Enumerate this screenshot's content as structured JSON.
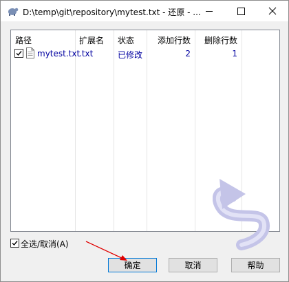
{
  "window": {
    "title": "D:\\temp\\git\\repository\\mytest.txt - 还原 - ..."
  },
  "columns": [
    "路径",
    "扩展名",
    "状态",
    "添加行数",
    "删除行数"
  ],
  "rows": [
    {
      "checked": true,
      "path": "mytest.txt",
      "ext": ".txt",
      "status": "已修改",
      "added": "2",
      "removed": "1"
    }
  ],
  "select_all": {
    "checked": true,
    "label": "全选/取消(A)"
  },
  "buttons": {
    "ok": "确定",
    "cancel": "取消",
    "help": "帮助"
  },
  "colors": {
    "accent": "#0078d7",
    "row_text": "#0000a0",
    "annotation_arrow": "#e00000",
    "watermark": "#b8b8e0"
  }
}
